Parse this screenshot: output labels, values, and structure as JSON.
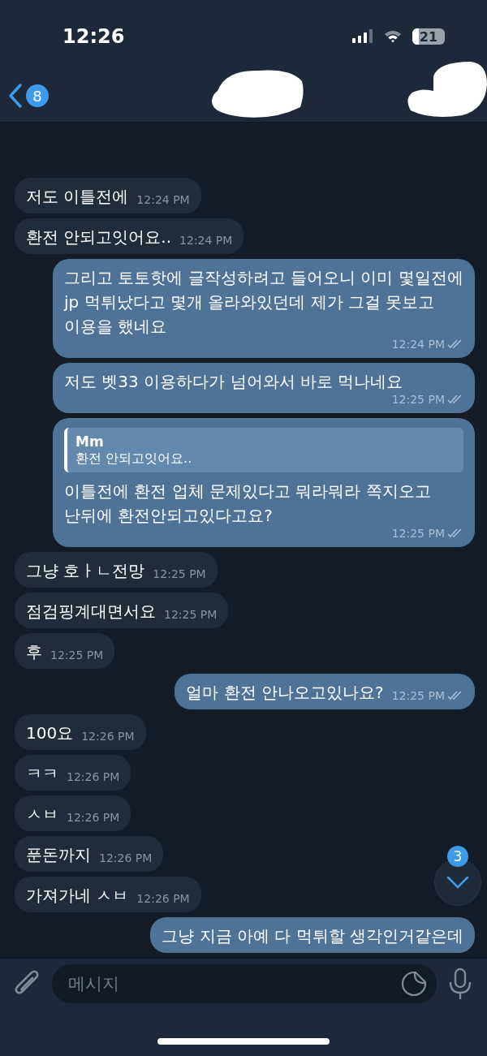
{
  "status_bar": {
    "time": "12:26",
    "battery": "21"
  },
  "header": {
    "back_badge": "8"
  },
  "messages": [
    {
      "kind": "incoming",
      "text": "저도 이틀전에",
      "time": "12:24 PM"
    },
    {
      "kind": "incoming",
      "text": "환전 안되고잇어요..",
      "time": "12:24 PM"
    },
    {
      "kind": "outgoing",
      "text": "그리고 토토핫에 글작성하려고 들어오니 이미 몇일전에 jp 먹튀났다고 몇개 올라와있던데 제가 그걸 못보고 이용을 했네요",
      "time": "12:24 PM",
      "read": true
    },
    {
      "kind": "outgoing",
      "text": "저도 벳33 이용하다가 넘어와서 바로 먹나네요",
      "time": "12:25 PM",
      "read": true
    },
    {
      "kind": "outgoing",
      "reply": {
        "author": "Mm",
        "text": "환전 안되고잇어요.."
      },
      "text": "이틀전에 환전 업체 문제있다고 뭐라뭐라 쪽지오고 난뒤에 환전안되고있다고요?",
      "time": "12:25 PM",
      "read": true
    },
    {
      "kind": "incoming",
      "text": "그냥 호ㅏㄴ전망",
      "time": "12:25 PM"
    },
    {
      "kind": "incoming",
      "text": "점검핑계대면서요",
      "time": "12:25 PM"
    },
    {
      "kind": "incoming",
      "text": "후",
      "time": "12:25 PM"
    },
    {
      "kind": "outgoing",
      "text": "얼마 환전 안나오고있나요?",
      "time": "12:25 PM",
      "read": true
    },
    {
      "kind": "incoming",
      "text": "100요",
      "time": "12:26 PM"
    },
    {
      "kind": "incoming",
      "text": "ㅋㅋ",
      "time": "12:26 PM"
    },
    {
      "kind": "incoming",
      "text": "ㅅㅂ",
      "time": "12:26 PM"
    },
    {
      "kind": "incoming",
      "text": "푼돈까지",
      "time": "12:26 PM"
    },
    {
      "kind": "incoming",
      "text": "가져가네 ㅅㅂ",
      "time": "12:26 PM"
    },
    {
      "kind": "outgoing",
      "text": "그냥 지금 아예 다 먹튀할 생각인거같은데"
    }
  ],
  "scroll_button": {
    "badge": "3"
  },
  "composer": {
    "placeholder": "메시지"
  }
}
